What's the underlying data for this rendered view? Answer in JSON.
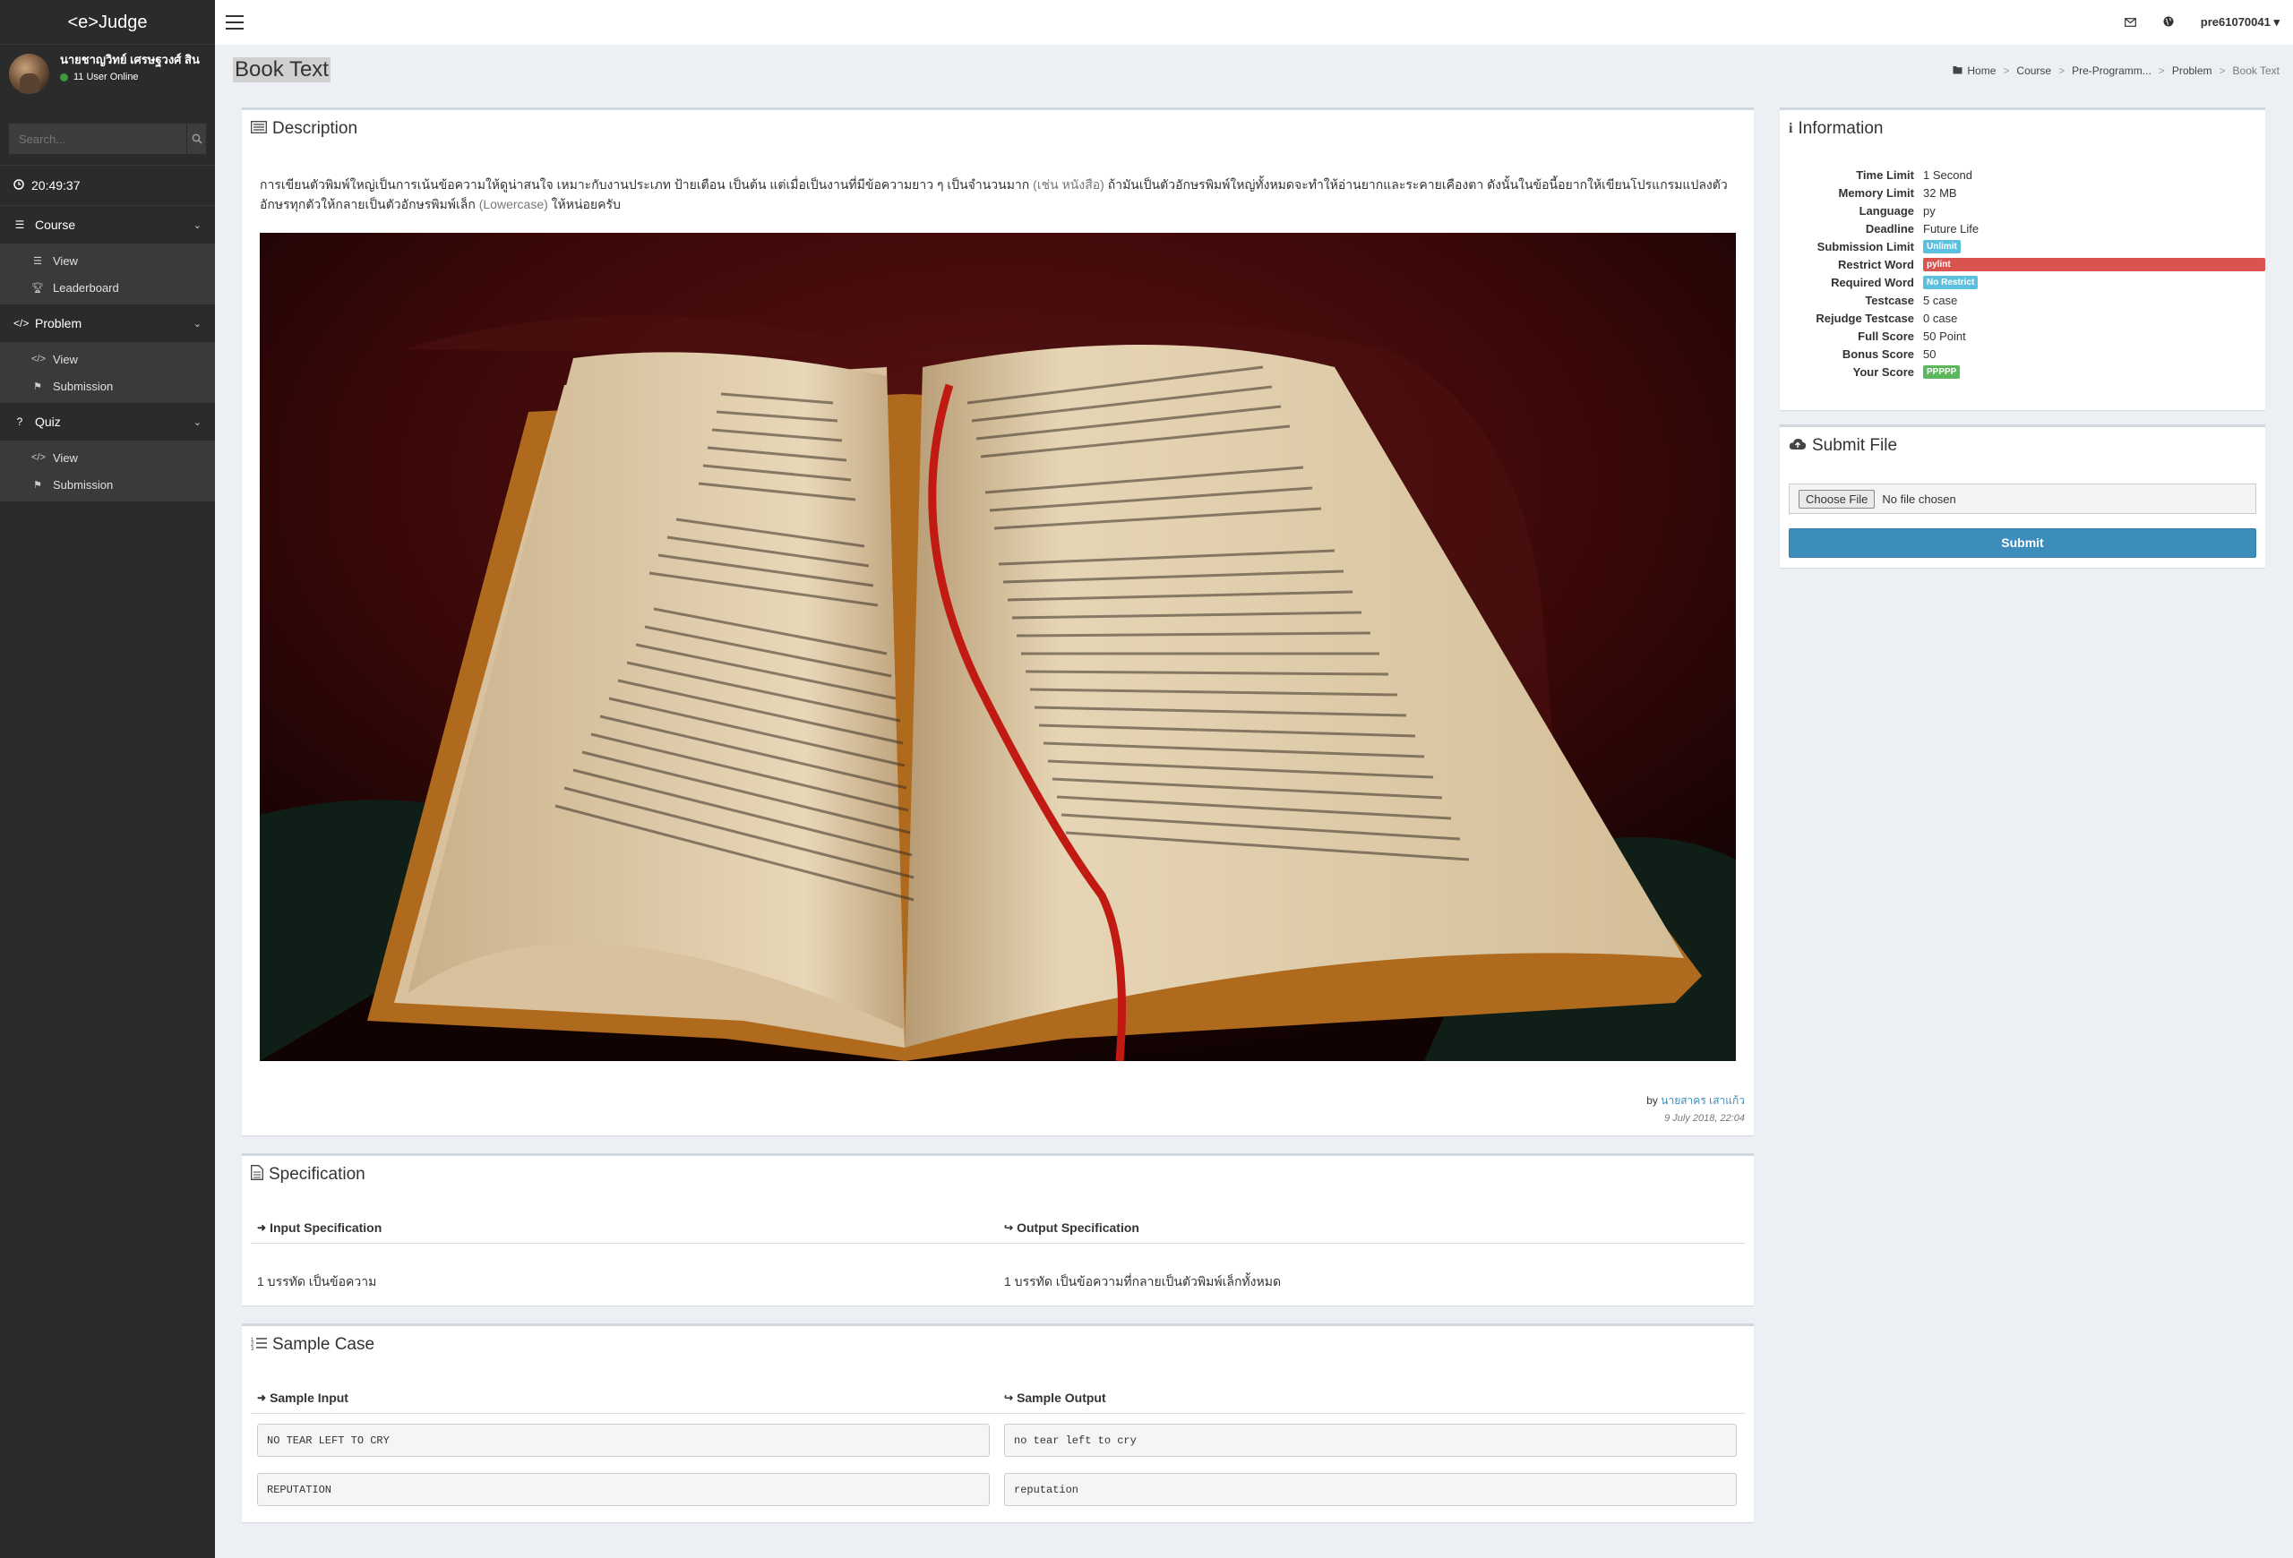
{
  "app": {
    "brand": "<e>Judge"
  },
  "user": {
    "name": "นายชาญวิทย์ เศรษฐวงศ์ สิน",
    "status": "11 User Online"
  },
  "search": {
    "placeholder": "Search..."
  },
  "clock": "20:49:37",
  "menu": {
    "course": {
      "label": "Course",
      "items": [
        "View",
        "Leaderboard"
      ]
    },
    "problem": {
      "label": "Problem",
      "items": [
        "View",
        "Submission"
      ]
    },
    "quiz": {
      "label": "Quiz",
      "items": [
        "View",
        "Submission"
      ]
    }
  },
  "topbar": {
    "username": "pre61070041"
  },
  "page": {
    "title": "Book Text"
  },
  "breadcrumb": [
    "Home",
    "Course",
    "Pre-Programm...",
    "Problem",
    "Book Text"
  ],
  "description": {
    "title": "Description",
    "text_part1": "การเขียนตัวพิมพ์ใหญ่เป็นการเน้นข้อความให้ดูน่าสนใจ เหมาะกับงานประเภท ป้ายเตือน เป็นต้น แต่เมื่อเป็นงานที่มีข้อความยาว ๆ เป็นจำนวนมาก ",
    "text_muted1": "(เช่น หนังสือ)",
    "text_part2": " ถ้ามันเป็นตัวอักษรพิมพ์ใหญ่ทั้งหมดจะทำให้อ่านยากและระคายเคืองตา ดังนั้นในข้อนี้อยากให้เขียนโปรแกรมแปลงตัวอักษรทุกตัวให้กลายเป็นตัวอักษรพิมพ์เล็ก ",
    "text_muted2": "(Lowercase)",
    "text_part3": " ให้หน่อยครับ",
    "by_prefix": "by",
    "author": "นายสาคร เสาแก้ว",
    "date": "9 July 2018, 22:04"
  },
  "specification": {
    "title": "Specification",
    "input_title": "Input Specification",
    "output_title": "Output Specification",
    "input_text": "1 บรรทัด เป็นข้อความ",
    "output_text": "1 บรรทัด เป็นข้อความที่กลายเป็นตัวพิมพ์เล็กทั้งหมด"
  },
  "sample": {
    "title": "Sample Case",
    "input_title": "Sample Input",
    "output_title": "Sample Output",
    "cases": [
      {
        "input": "NO TEAR LEFT TO CRY",
        "output": "no tear left to cry"
      },
      {
        "input": "REPUTATION",
        "output": "reputation"
      }
    ]
  },
  "information": {
    "title": "Information",
    "rows": [
      {
        "key": "Time Limit",
        "value": "1 Second"
      },
      {
        "key": "Memory Limit",
        "value": "32 MB"
      },
      {
        "key": "Language",
        "value": "py"
      },
      {
        "key": "Deadline",
        "value": "Future Life"
      },
      {
        "key": "Submission Limit",
        "value": "Unlimit"
      },
      {
        "key": "Restrict Word",
        "value": "pylint"
      },
      {
        "key": "Required Word",
        "value": "No Restrict"
      },
      {
        "key": "Testcase",
        "value": "5 case"
      },
      {
        "key": "Rejudge Testcase",
        "value": "0 case"
      },
      {
        "key": "Full Score",
        "value": "50 Point"
      },
      {
        "key": "Bonus Score",
        "value": "50"
      },
      {
        "key": "Your Score",
        "value": "PPPPP"
      }
    ]
  },
  "submit": {
    "title": "Submit File",
    "choose_label": "Choose File",
    "no_file": "No file chosen",
    "button": "Submit"
  }
}
